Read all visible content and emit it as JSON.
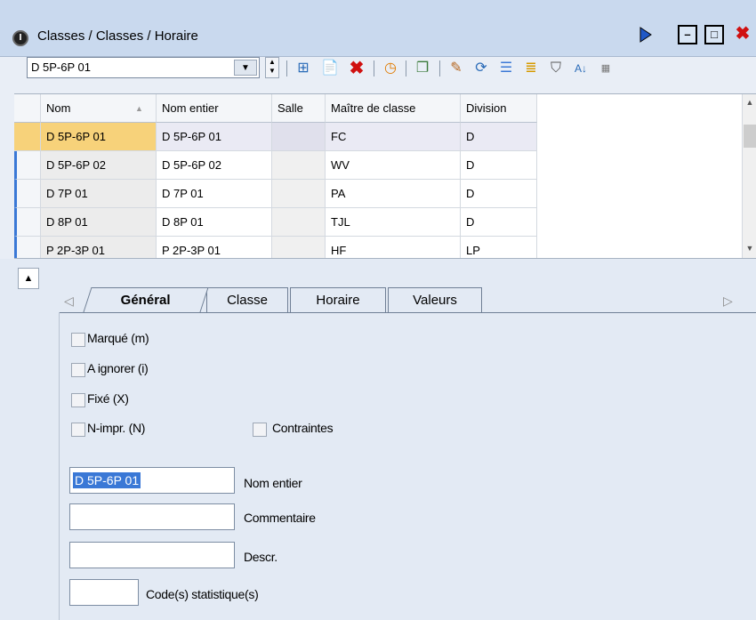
{
  "window": {
    "title": "Classes / Classes / Horaire"
  },
  "toolbar": {
    "combo_value": "D 5P-6P 01",
    "icons": [
      "grid-icon",
      "new-icon",
      "delete-icon",
      "clock-icon",
      "copy-icon",
      "palette-icon",
      "refresh-icon",
      "list-icon",
      "edit-list-icon",
      "filter-icon",
      "sort-icon",
      "table-settings-icon"
    ]
  },
  "grid": {
    "columns": [
      "Nom",
      "Nom entier",
      "Salle",
      "Maître de classe",
      "Division"
    ],
    "rows": [
      [
        "D 5P-6P 01",
        "D 5P-6P 01",
        "",
        "FC",
        "D"
      ],
      [
        "D 5P-6P 02",
        "D 5P-6P 02",
        "",
        "WV",
        "D"
      ],
      [
        "D 7P 01",
        "D 7P 01",
        "",
        "PA",
        "D"
      ],
      [
        "D 8P 01",
        "D 8P 01",
        "",
        "TJL",
        "D"
      ],
      [
        "P 2P-3P 01",
        "P 2P-3P 01",
        "",
        "HF",
        "LP"
      ]
    ],
    "selected_row": 0
  },
  "tabs": [
    "Général",
    "Classe",
    "Horaire",
    "Valeurs"
  ],
  "general": {
    "checkboxes": {
      "marque": "Marqué (m)",
      "ignorer": "A ignorer (i)",
      "fixe": "Fixé (X)",
      "nimpr": "N-impr. (N)",
      "contraintes": "Contraintes"
    },
    "nom_entier_value": "D 5P-6P 01",
    "labels": {
      "nom_entier": "Nom entier",
      "commentaire": "Commentaire",
      "descr": "Descr.",
      "code_stat": "Code(s) statistique(s)"
    }
  },
  "colors": {
    "titlebar": "#c9d9ee",
    "panel": "#e3eaf4",
    "selection": "#3a78d6",
    "close": "#d01010"
  }
}
